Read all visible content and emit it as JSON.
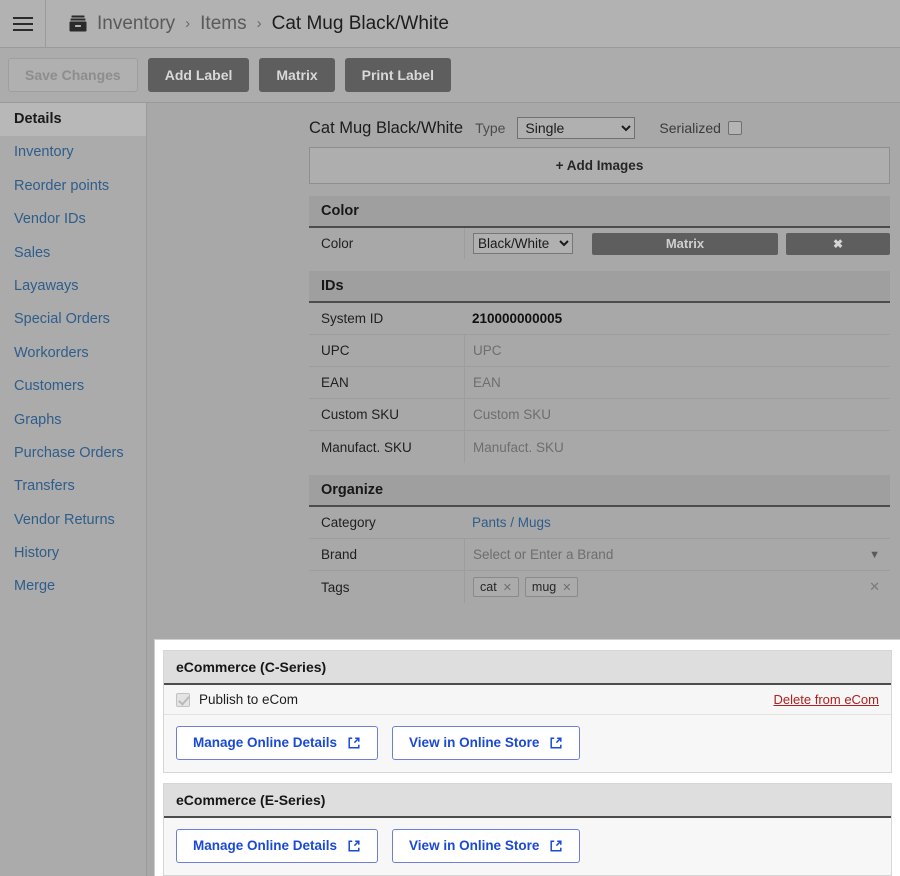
{
  "topbar": {
    "menu_icon": "hamburger-icon",
    "breadcrumb_icon": "archive-box-icon",
    "breadcrumb": [
      "Inventory",
      "Items",
      "Cat Mug Black/White"
    ],
    "separator": "›"
  },
  "actionbar": {
    "buttons": [
      {
        "label": "Save Changes",
        "state": "disabled"
      },
      {
        "label": "Add Label",
        "state": "enabled"
      },
      {
        "label": "Matrix",
        "state": "enabled"
      },
      {
        "label": "Print Label",
        "state": "enabled"
      }
    ]
  },
  "sidebar": {
    "items": [
      {
        "label": "Details",
        "active": true
      },
      {
        "label": "Inventory",
        "active": false
      },
      {
        "label": "Reorder points",
        "active": false
      },
      {
        "label": "Vendor IDs",
        "active": false
      },
      {
        "label": "Sales",
        "active": false
      },
      {
        "label": "Layaways",
        "active": false
      },
      {
        "label": "Special Orders",
        "active": false
      },
      {
        "label": "Workorders",
        "active": false
      },
      {
        "label": "Customers",
        "active": false
      },
      {
        "label": "Graphs",
        "active": false
      },
      {
        "label": "Purchase Orders",
        "active": false
      },
      {
        "label": "Transfers",
        "active": false
      },
      {
        "label": "Vendor Returns",
        "active": false
      },
      {
        "label": "History",
        "active": false
      },
      {
        "label": "Merge",
        "active": false
      }
    ]
  },
  "item_header": {
    "title": "Cat Mug Black/White",
    "type_label": "Type",
    "type_value": "Single",
    "type_options": [
      "Single"
    ],
    "serialized_label": "Serialized",
    "serialized_checked": false
  },
  "add_images": {
    "label": "+ Add Images"
  },
  "color_section": {
    "heading": "Color",
    "row_label": "Color",
    "selected": "Black/White",
    "options": [
      "Black/White"
    ],
    "matrix_button": "Matrix",
    "remove_button": "✖"
  },
  "ids_section": {
    "heading": "IDs",
    "rows": [
      {
        "label": "System ID",
        "value": "210000000005",
        "placeholder": "",
        "bold": true
      },
      {
        "label": "UPC",
        "value": "",
        "placeholder": "UPC",
        "bold": false
      },
      {
        "label": "EAN",
        "value": "",
        "placeholder": "EAN",
        "bold": false
      },
      {
        "label": "Custom SKU",
        "value": "",
        "placeholder": "Custom SKU",
        "bold": false
      },
      {
        "label": "Manufact. SKU",
        "value": "",
        "placeholder": "Manufact. SKU",
        "bold": false
      }
    ]
  },
  "organize_section": {
    "heading": "Organize",
    "category_label": "Category",
    "category_value": "Pants / Mugs",
    "brand_label": "Brand",
    "brand_placeholder": "Select or Enter a Brand",
    "brand_caret": "▼",
    "tags_label": "Tags",
    "tags": [
      "cat",
      "mug"
    ],
    "tag_remove": "✕",
    "tags_clear": "✕"
  },
  "ecommerce_c": {
    "heading": "eCommerce (C-Series)",
    "publish_label": "Publish to eCom",
    "publish_checked": true,
    "delete_link": "Delete from eCom",
    "manage_button": "Manage Online Details",
    "view_button": "View in Online Store",
    "external_icon": "external-link-icon"
  },
  "ecommerce_e": {
    "heading": "eCommerce (E-Series)",
    "manage_button": "Manage Online Details",
    "view_button": "View in Online Store",
    "external_icon": "external-link-icon"
  },
  "colors": {
    "page_bg": "#a8a8a8",
    "sidebar_bg": "#ababab",
    "link": "#2f5d8a",
    "dark_button": "#5e5e5e",
    "ecom_accent": "#1a49d6",
    "delete_link": "#b02020"
  }
}
